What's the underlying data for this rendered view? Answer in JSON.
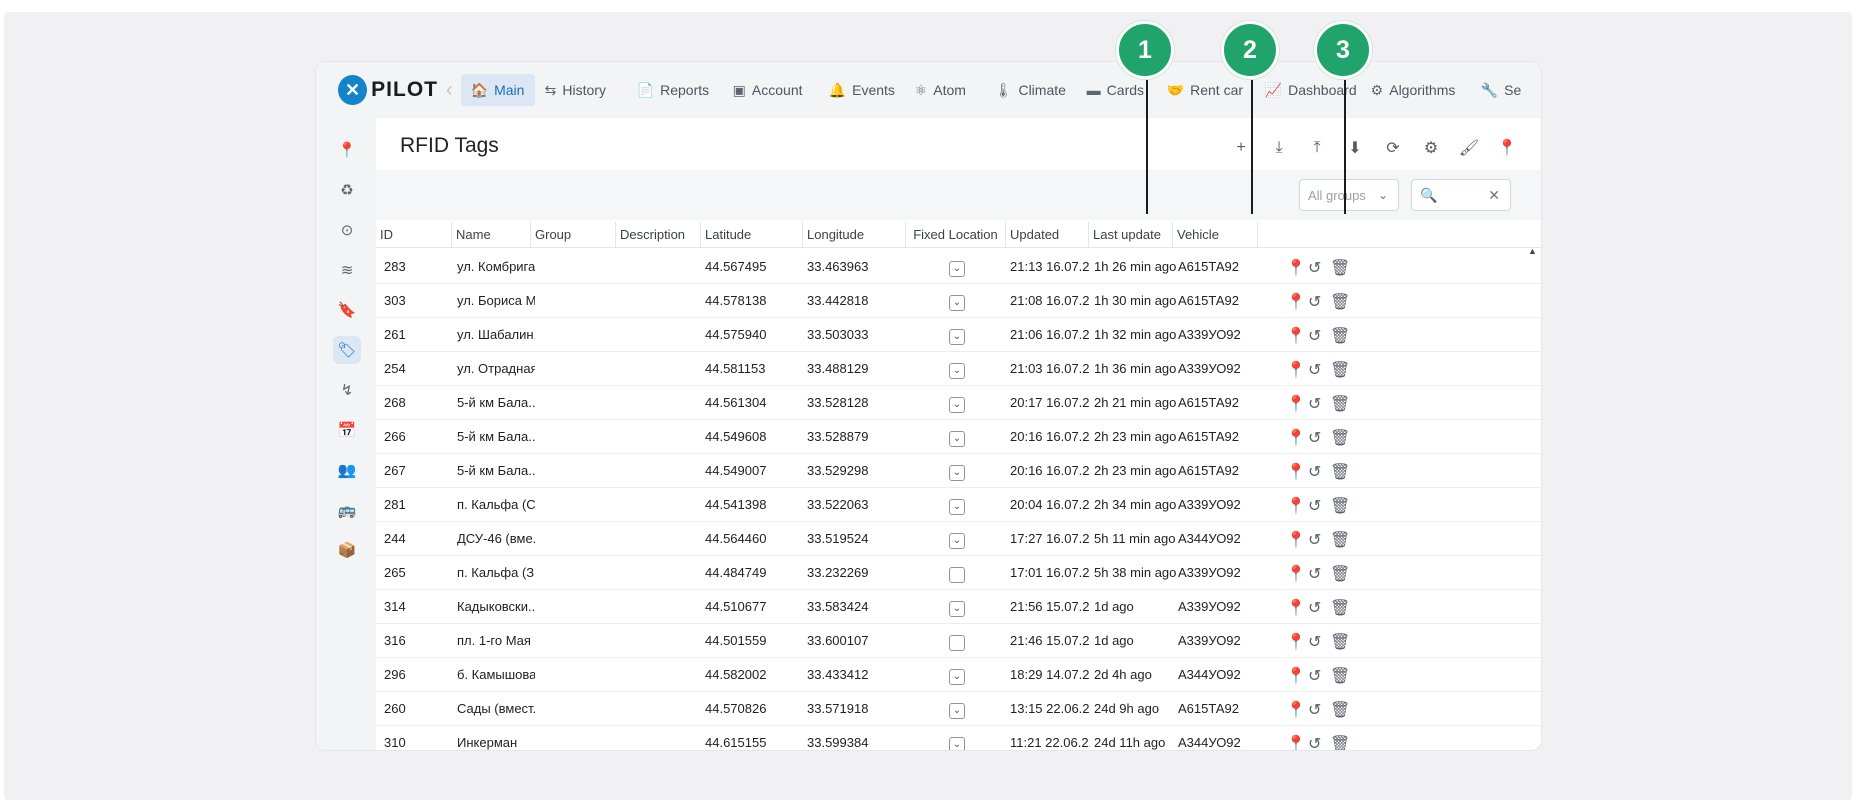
{
  "logo": {
    "text": "PILOT",
    "mark_icon": "pilot-logo"
  },
  "nav": {
    "back": "‹",
    "items": [
      {
        "label": "Main",
        "icon": "🏠"
      },
      {
        "label": "History",
        "icon": "⇆"
      },
      {
        "label": "Reports",
        "icon": "📄"
      },
      {
        "label": "Account",
        "icon": "▣"
      },
      {
        "label": "Events",
        "icon": "🔔"
      },
      {
        "label": "Atom",
        "icon": "⚛"
      },
      {
        "label": "Climate",
        "icon": "🌡"
      },
      {
        "label": "Cards",
        "icon": "▬"
      },
      {
        "label": "Rent car",
        "icon": "🤝"
      },
      {
        "label": "Dashboard",
        "icon": "📈"
      },
      {
        "label": "Algorithms",
        "icon": "⚙"
      },
      {
        "label": "Se",
        "icon": "🔧"
      }
    ]
  },
  "rail": {
    "items": [
      "📍",
      "♻",
      "⊙",
      "≋",
      "🔖",
      "🏷",
      "↯",
      "📅",
      "👥",
      "🚌",
      "📦"
    ]
  },
  "page": {
    "title": "RFID Tags"
  },
  "toolbar": {
    "icons": [
      "+",
      "⤓",
      "⤒",
      "⬇",
      "⟳",
      "⚙",
      "🖌",
      "📍"
    ]
  },
  "filter": {
    "group_placeholder": "All groups",
    "chevron": "⌄",
    "search_icon": "🔍",
    "clear": "✕"
  },
  "columns": [
    "ID",
    "Name",
    "Group",
    "Description",
    "Latitude",
    "Longitude",
    "Fixed Location",
    "Updated",
    "Last update",
    "Vehicle"
  ],
  "rows": [
    {
      "id": "283",
      "name": "ул. Комбрига...",
      "lat": "44.567495",
      "lon": "33.463963",
      "fixed": true,
      "updated": "21:13 16.07.2...",
      "last": "1h 26 min ago",
      "vehicle": "А615ТА92",
      "pin": "green"
    },
    {
      "id": "303",
      "name": "ул. Бориса М...",
      "lat": "44.578138",
      "lon": "33.442818",
      "fixed": true,
      "updated": "21:08 16.07.2...",
      "last": "1h 30 min ago",
      "vehicle": "А615ТА92",
      "pin": "green"
    },
    {
      "id": "261",
      "name": "ул. Шабалин...",
      "lat": "44.575940",
      "lon": "33.503033",
      "fixed": true,
      "updated": "21:06 16.07.2...",
      "last": "1h 32 min ago",
      "vehicle": "А339УО92",
      "pin": "green"
    },
    {
      "id": "254",
      "name": "ул. Отрадная...",
      "lat": "44.581153",
      "lon": "33.488129",
      "fixed": true,
      "updated": "21:03 16.07.2...",
      "last": "1h 36 min ago",
      "vehicle": "А339УО92",
      "pin": "green"
    },
    {
      "id": "268",
      "name": "5-й км Бала...",
      "lat": "44.561304",
      "lon": "33.528128",
      "fixed": true,
      "updated": "20:17 16.07.2...",
      "last": "2h 21 min ago",
      "vehicle": "А615ТА92",
      "pin": "green"
    },
    {
      "id": "266",
      "name": "5-й км Бала...",
      "lat": "44.549608",
      "lon": "33.528879",
      "fixed": true,
      "updated": "20:16 16.07.2...",
      "last": "2h 23 min ago",
      "vehicle": "А615ТА92",
      "pin": "green"
    },
    {
      "id": "267",
      "name": "5-й км Бала...",
      "lat": "44.549007",
      "lon": "33.529298",
      "fixed": true,
      "updated": "20:16 16.07.2...",
      "last": "2h 23 min ago",
      "vehicle": "А615ТА92",
      "pin": "green"
    },
    {
      "id": "281",
      "name": "п. Кальфа (С...",
      "lat": "44.541398",
      "lon": "33.522063",
      "fixed": true,
      "updated": "20:04 16.07.2...",
      "last": "2h 34 min ago",
      "vehicle": "А339УО92",
      "pin": "green"
    },
    {
      "id": "244",
      "name": "ДСУ-46 (вме...",
      "lat": "44.564460",
      "lon": "33.519524",
      "fixed": true,
      "updated": "17:27 16.07.2...",
      "last": "5h 11 min ago",
      "vehicle": "А344УО92",
      "pin": "red"
    },
    {
      "id": "265",
      "name": "п. Кальфа (З...",
      "lat": "44.484749",
      "lon": "33.232269",
      "fixed": false,
      "updated": "17:01 16.07.2...",
      "last": "5h 38 min ago",
      "vehicle": "А339УО92",
      "pin": "red"
    },
    {
      "id": "314",
      "name": "Кадыковски...",
      "lat": "44.510677",
      "lon": "33.583424",
      "fixed": true,
      "updated": "21:56 15.07.2...",
      "last": "1d ago",
      "vehicle": "А339УО92",
      "pin": "red"
    },
    {
      "id": "316",
      "name": "пл. 1-го Мая ...",
      "lat": "44.501559",
      "lon": "33.600107",
      "fixed": false,
      "updated": "21:46 15.07.2...",
      "last": "1d ago",
      "vehicle": "А339УО92",
      "pin": "red"
    },
    {
      "id": "296",
      "name": "б. Камышова...",
      "lat": "44.582002",
      "lon": "33.433412",
      "fixed": true,
      "updated": "18:29 14.07.2...",
      "last": "2d 4h ago",
      "vehicle": "А344УО92",
      "pin": "red"
    },
    {
      "id": "260",
      "name": "Сады (вмест...",
      "lat": "44.570826",
      "lon": "33.571918",
      "fixed": true,
      "updated": "13:15 22.06.2...",
      "last": "24d 9h ago",
      "vehicle": "А615ТА92",
      "pin": "red"
    },
    {
      "id": "310",
      "name": "Инкерман",
      "lat": "44.615155",
      "lon": "33.599384",
      "fixed": true,
      "updated": "11:21 22.06.2...",
      "last": "24d 11h ago",
      "vehicle": "А344УО92",
      "pin": "red"
    }
  ],
  "row_actions": {
    "pin": "📍",
    "history": "↺",
    "delete": "🗑",
    "check": "⌄"
  },
  "markers": [
    "1",
    "2",
    "3"
  ],
  "colors": {
    "accent": "#1a6fb5",
    "marker": "#20a46c",
    "pin_green": "#1e8b3a",
    "pin_red": "#c4161c"
  }
}
